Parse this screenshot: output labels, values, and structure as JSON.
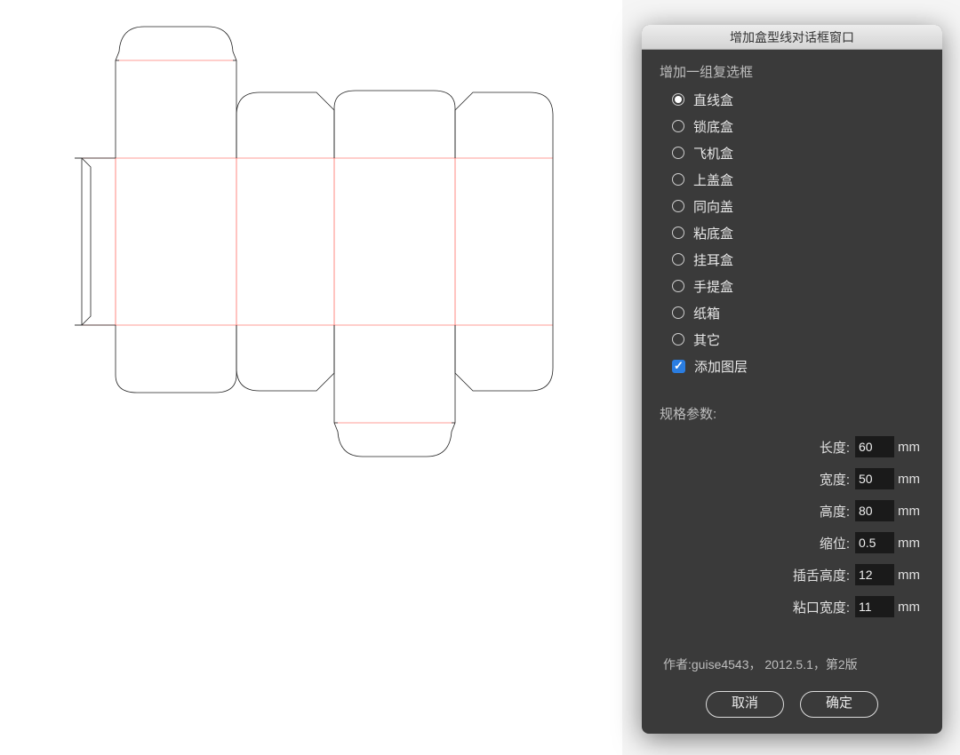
{
  "dialog": {
    "title": "增加盒型线对话框窗口",
    "group_label": "增加一组复选框",
    "options": [
      {
        "label": "直线盒",
        "checked": true
      },
      {
        "label": "锁底盒",
        "checked": false
      },
      {
        "label": "飞机盒",
        "checked": false
      },
      {
        "label": "上盖盒",
        "checked": false
      },
      {
        "label": "同向盖",
        "checked": false
      },
      {
        "label": "粘底盒",
        "checked": false
      },
      {
        "label": "挂耳盒",
        "checked": false
      },
      {
        "label": "手提盒",
        "checked": false
      },
      {
        "label": "纸箱",
        "checked": false
      },
      {
        "label": "其它",
        "checked": false
      }
    ],
    "add_layer_label": "添加图层",
    "add_layer_checked": true,
    "params_label": "规格参数:",
    "params": [
      {
        "name": "长度:",
        "value": "60",
        "unit": "mm"
      },
      {
        "name": "宽度:",
        "value": "50",
        "unit": "mm"
      },
      {
        "name": "高度:",
        "value": "80",
        "unit": "mm"
      },
      {
        "name": "缩位:",
        "value": "0.5",
        "unit": "mm"
      },
      {
        "name": "插舌高度:",
        "value": "12",
        "unit": "mm"
      },
      {
        "name": "粘口宽度:",
        "value": "11",
        "unit": "mm"
      }
    ],
    "credit": "作者:guise4543，  2012.5.1，第2版",
    "cancel_label": "取消",
    "ok_label": "确定"
  }
}
